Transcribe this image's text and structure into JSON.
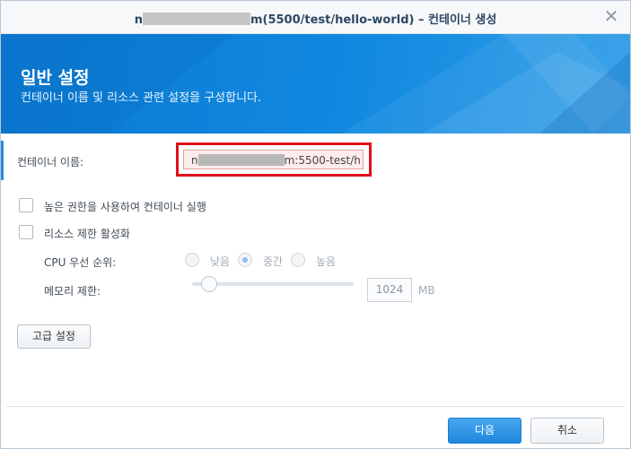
{
  "window": {
    "title_prefix": "n",
    "title_suffix": "m(5500/test/hello-world) – 컨테이너 생성",
    "close_symbol": "✕"
  },
  "banner": {
    "title": "일반 설정",
    "subtitle": "컨테이너 이름 및 리소스 관련 설정을 구성합니다."
  },
  "form": {
    "container_name_label": "컨테이너 이름:",
    "container_name_prefix": "n",
    "container_name_suffix": "m:5500-test/h",
    "run_privileged_label": "높은 권한을 사용하여 컨테이너 실행",
    "run_privileged_checked": false,
    "resource_limit_label": "리소스 제한 활성화",
    "resource_limit_checked": false,
    "cpu_priority_label": "CPU 우선 순위:",
    "cpu_options": [
      "낮음",
      "중간",
      "높음"
    ],
    "cpu_selected": "중간",
    "memory_limit_label": "메모리 제한:",
    "memory_value": "1024",
    "memory_unit": "MB",
    "advanced_button": "고급 설정"
  },
  "footer": {
    "next_button": "다음",
    "cancel_button": "취소"
  },
  "colors": {
    "banner": "#1189e0",
    "highlight_border": "#e00f1c",
    "primary_button": "#2086dc"
  }
}
